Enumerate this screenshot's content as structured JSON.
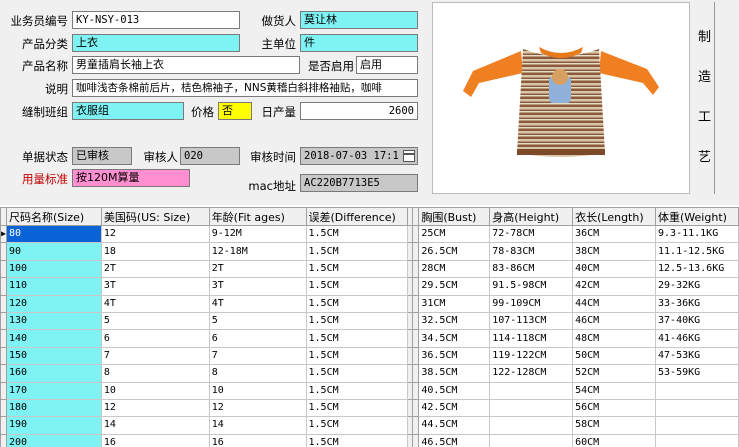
{
  "form": {
    "salesman_code_label": "业务员编号",
    "salesman_code": "KY-NSY-013",
    "supplier_label": "做货人",
    "supplier": "莫让林",
    "category_label": "产品分类",
    "category": "上衣",
    "main_unit_label": "主单位",
    "main_unit": "件",
    "product_name_label": "产品名称",
    "product_name": "男童插肩长袖上衣",
    "enabled_label": "是否启用",
    "enabled": "启用",
    "desc_label": "说明",
    "desc": "咖啡浅杏条棉前后片，桔色棉袖子，NNS黄稽白斜排格袖贴，咖啡",
    "sewing_group_label": "缝制班组",
    "sewing_group": "衣服组",
    "price_label": "价格",
    "price": "否",
    "daily_output_label": "日产量",
    "daily_output": "2600",
    "doc_status_label": "单据状态",
    "doc_status": "已审核",
    "reviewer_label": "审核人",
    "reviewer": "020",
    "review_time_label": "审核时间",
    "review_time": "2018-07-03  17:1",
    "usage_label": "用量标准",
    "usage": "按120M算量",
    "mac_label": "mac地址",
    "mac": "AC220B7713E5"
  },
  "side_label": [
    "制",
    "造",
    "工",
    "艺"
  ],
  "table": {
    "headers": [
      "尺码名称(Size)",
      "美国码(US: Size)",
      "年龄(Fit ages)",
      "误差(Difference)",
      "胸围(Bust)",
      "身高(Height)",
      "衣长(Length)",
      "体重(Weight)"
    ],
    "rows": [
      [
        "80",
        "12",
        "9-12M",
        "1.5CM",
        "25CM",
        "72-78CM",
        "36CM",
        "9.3-11.1KG"
      ],
      [
        "90",
        "18",
        "12-18M",
        "1.5CM",
        "26.5CM",
        "78-83CM",
        "38CM",
        "11.1-12.5KG"
      ],
      [
        "100",
        "2T",
        "2T",
        "1.5CM",
        "28CM",
        "83-86CM",
        "40CM",
        "12.5-13.6KG"
      ],
      [
        "110",
        "3T",
        "3T",
        "1.5CM",
        "29.5CM",
        "91.5-98CM",
        "42CM",
        "29-32KG"
      ],
      [
        "120",
        "4T",
        "4T",
        "1.5CM",
        "31CM",
        "99-109CM",
        "44CM",
        "33-36KG"
      ],
      [
        "130",
        "5",
        "5",
        "1.5CM",
        "32.5CM",
        "107-113CM",
        "46CM",
        "37-40KG"
      ],
      [
        "140",
        "6",
        "6",
        "1.5CM",
        "34.5CM",
        "114-118CM",
        "48CM",
        "41-46KG"
      ],
      [
        "150",
        "7",
        "7",
        "1.5CM",
        "36.5CM",
        "119-122CM",
        "50CM",
        "47-53KG"
      ],
      [
        "160",
        "8",
        "8",
        "1.5CM",
        "38.5CM",
        "122-128CM",
        "52CM",
        "53-59KG"
      ],
      [
        "170",
        "10",
        "10",
        "1.5CM",
        "40.5CM",
        "",
        "54CM",
        ""
      ],
      [
        "180",
        "12",
        "12",
        "1.5CM",
        "42.5CM",
        "",
        "56CM",
        ""
      ],
      [
        "190",
        "14",
        "14",
        "1.5CM",
        "44.5CM",
        "",
        "58CM",
        ""
      ],
      [
        "200",
        "16",
        "16",
        "1.5CM",
        "46.5CM",
        "",
        "60CM",
        ""
      ]
    ]
  }
}
